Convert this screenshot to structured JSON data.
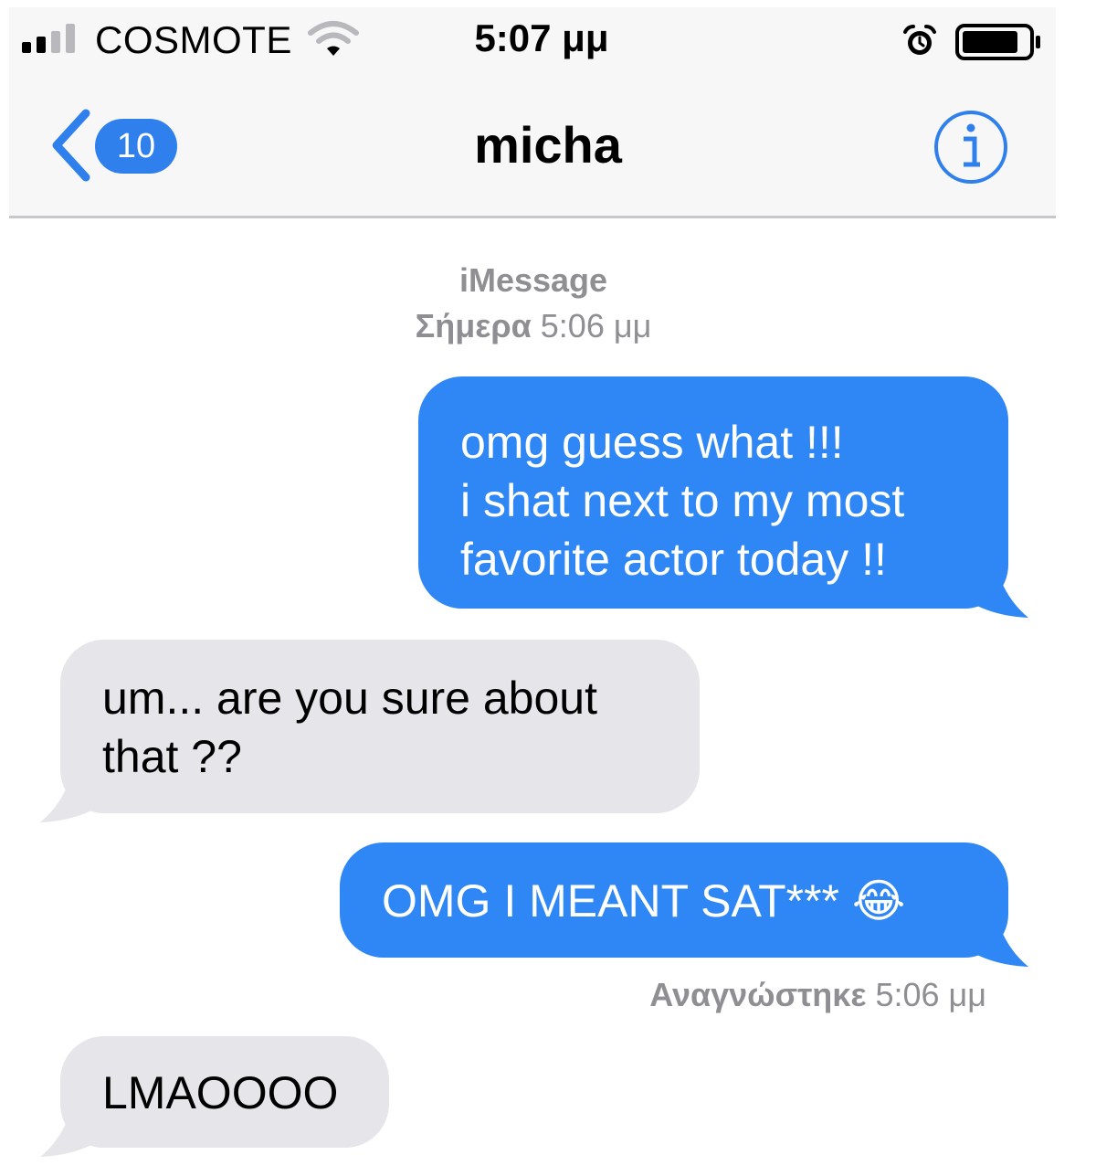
{
  "status_bar": {
    "carrier": "COSMOTE",
    "time": "5:07 μμ",
    "signal_bars_filled": 2,
    "signal_bars_total": 4,
    "battery_level": 0.85,
    "icons": [
      "signal-icon",
      "wifi-icon",
      "alarm-icon",
      "battery-icon"
    ]
  },
  "nav": {
    "back_badge": "10",
    "contact_name": "micha",
    "icons": [
      "chevron-left-icon",
      "info-icon"
    ]
  },
  "conversation": {
    "service": "iMessage",
    "timestamp_day": "Σήμερα",
    "timestamp_time": "5:06 μμ",
    "messages": [
      {
        "direction": "sent",
        "lines": [
          "omg guess what !!!",
          "i shat next to my most",
          "favorite actor today !!"
        ]
      },
      {
        "direction": "received",
        "lines": [
          "um... are you sure about",
          "that ??"
        ]
      },
      {
        "direction": "sent",
        "text": "OMG I MEANT SAT***",
        "emoji": "😂"
      },
      {
        "direction": "received",
        "text": "LMAOOOO"
      }
    ],
    "read_receipt_label": "Αναγνώστηκε",
    "read_receipt_time": "5:06 μμ"
  },
  "colors": {
    "accent": "#2f80ed",
    "sent_bubble": "#2f86f5",
    "received_bubble": "#e5e5ea",
    "secondary_text": "#8e8e93",
    "nav_background": "#f7f7f7"
  }
}
